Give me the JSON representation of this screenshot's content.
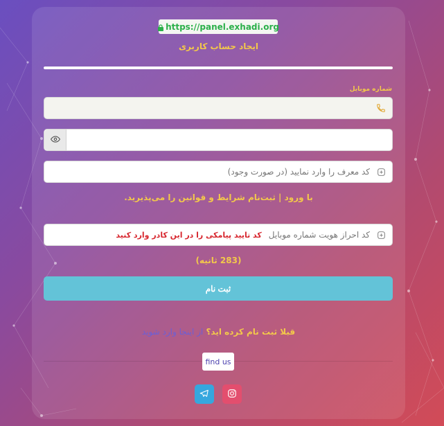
{
  "url_badge": {
    "text": "https://panel.exhadi.org"
  },
  "form": {
    "title": "ایجاد حساب کاربری",
    "progress_fraction": 1.0,
    "phone": {
      "label": "شماره موبایل",
      "value": "",
      "placeholder": ""
    },
    "password": {
      "value": "",
      "placeholder": ""
    },
    "referral": {
      "placeholder": "کد معرف را وارد نمایید (در صورت وجود)"
    },
    "terms_text": "با ورود | ثبت‌نام شرایط و قوانین را می‌پذیرید.",
    "verify": {
      "placeholder": "کد احراز هویت شماره موبایل",
      "warning": "کد تایید پیامکی را در این کادر وارد کنید"
    },
    "timer_text": "(283 ثانیه)",
    "submit_label": "ثبت نام",
    "login_question": "قبلا ثبت نام کرده اید؟",
    "login_link": "از اینجا وارد شوید"
  },
  "footer": {
    "find_us_label": "find us"
  },
  "colors": {
    "accent_yellow": "#f3c84a",
    "submit": "#63c3d8",
    "telegram": "#36a7de",
    "instagram": "#e34e6e",
    "warning_red": "#d7262e"
  },
  "icons": {
    "url": "lock-icon",
    "phone": "phone-icon",
    "eye": "eye-icon",
    "referral": "ticket-icon",
    "verify": "ticket-icon",
    "telegram": "telegram-icon",
    "instagram": "instagram-icon"
  }
}
